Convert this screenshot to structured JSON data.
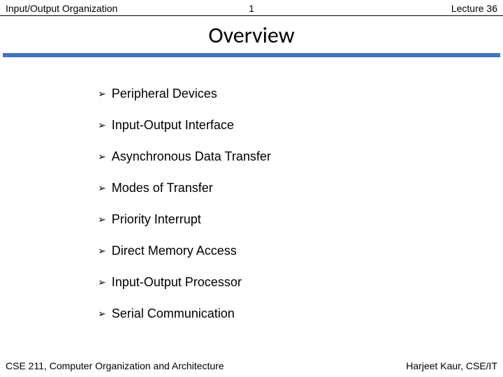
{
  "header": {
    "left": "Input/Output Organization",
    "center": "1",
    "right": "Lecture 36"
  },
  "title": "Overview",
  "bullets": {
    "item0": "Peripheral Devices",
    "item1": "Input-Output Interface",
    "item2": "Asynchronous Data Transfer",
    "item3": "Modes of Transfer",
    "item4": "Priority Interrupt",
    "item5": "Direct Memory Access",
    "item6": "Input-Output Processor",
    "item7": "Serial Communication"
  },
  "footer": {
    "left": "CSE 211, Computer Organization and Architecture",
    "right": "Harjeet Kaur, CSE/IT"
  }
}
